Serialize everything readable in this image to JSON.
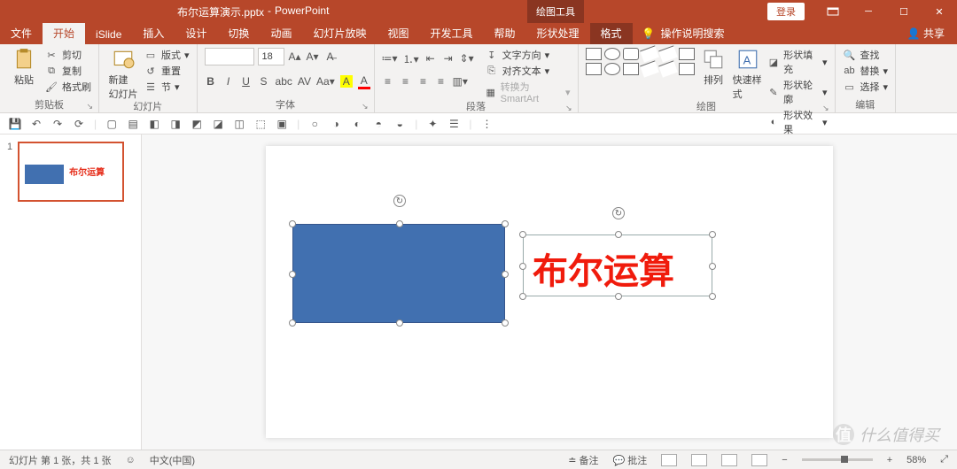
{
  "title": {
    "doc": "布尔运算演示.pptx",
    "app": "PowerPoint",
    "context_tab": "绘图工具",
    "login": "登录"
  },
  "tabs": {
    "file": "文件",
    "home": "开始",
    "islide": "iSlide",
    "insert": "插入",
    "design": "设计",
    "transition": "切换",
    "animation": "动画",
    "slideshow": "幻灯片放映",
    "view": "视图",
    "developer": "开发工具",
    "help": "帮助",
    "shapeproc": "形状处理",
    "format": "格式",
    "tell": "操作说明搜索",
    "share": "共享"
  },
  "ribbon": {
    "clipboard": {
      "paste": "粘贴",
      "cut": "剪切",
      "copy": "复制",
      "painter": "格式刷",
      "label": "剪贴板"
    },
    "slides": {
      "new": "新建\n幻灯片",
      "layout": "版式",
      "reset": "重置",
      "section": "节",
      "label": "幻灯片"
    },
    "font": {
      "name": "",
      "size": "18",
      "label": "字体"
    },
    "para": {
      "dir": "文字方向",
      "align": "对齐文本",
      "smart": "转换为 SmartArt",
      "label": "段落"
    },
    "draw": {
      "arrange": "排列",
      "quick": "快速样式",
      "fill": "形状填充",
      "outline": "形状轮廓",
      "effects": "形状效果",
      "label": "绘图"
    },
    "edit": {
      "find": "查找",
      "replace": "替换",
      "select": "选择",
      "label": "编辑"
    }
  },
  "thumb": {
    "num": "1",
    "text": "布尔运算"
  },
  "slide": {
    "text": "布尔运算"
  },
  "status": {
    "page": "幻灯片 第 1 张，共 1 张",
    "lang": "中文(中国)",
    "notes": "备注",
    "comments": "批注",
    "zoom": "58%"
  },
  "watermark": "什么值得买"
}
